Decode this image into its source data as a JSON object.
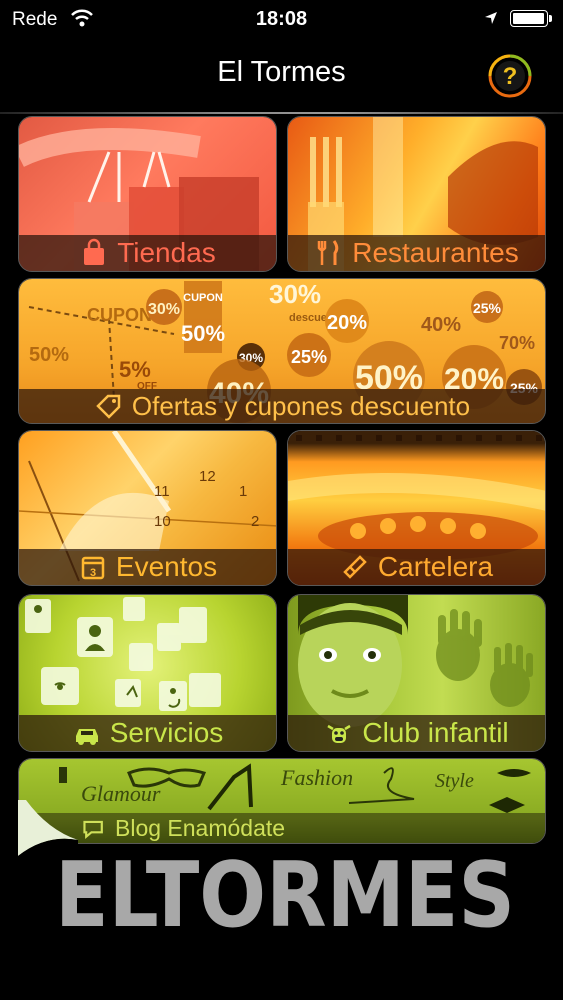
{
  "status_bar": {
    "carrier": "Rede",
    "time": "18:08",
    "battery_level": 1.0
  },
  "navbar": {
    "title": "El Tormes",
    "help_icon": "help-question-icon"
  },
  "tiles": {
    "tiendas": {
      "label": "Tiendas",
      "icon": "shopping-bag-icon"
    },
    "restaurantes": {
      "label": "Restaurantes",
      "icon": "fork-knife-icon"
    },
    "ofertas": {
      "label": "Ofertas y cupones descuento",
      "icon": "tag-icon",
      "art_text": [
        "CUPON",
        "30%",
        "50%",
        "5%",
        "OFF",
        "CUPON",
        "50%",
        "30%",
        "descuento",
        "20%",
        "40%",
        "25%",
        "70%",
        "25%",
        "50%",
        "20%",
        "30%",
        "40%",
        "25%"
      ]
    },
    "eventos": {
      "label": "Eventos",
      "icon": "calendar-icon",
      "art_text": [
        "12",
        "11",
        "10",
        "1",
        "2"
      ]
    },
    "cartelera": {
      "label": "Cartelera",
      "icon": "film-clapper-icon"
    },
    "servicios": {
      "label": "Servicios",
      "icon": "car-icon"
    },
    "club_infantil": {
      "label": "Club infantil",
      "icon": "mascot-cow-icon"
    },
    "blog": {
      "label": "Blog Enamódate",
      "icon": "chat-bubble-icon",
      "art_text": [
        "Glamour",
        "Fashion",
        "Style"
      ]
    }
  },
  "brand_logo": {
    "text": "ELTORMES"
  },
  "colors": {
    "background": "#000000",
    "tiendas": "#ff6a50",
    "restaurantes": "#ff8c3a",
    "ofertas": "#ffc04a",
    "eventos": "#ffb830",
    "cartelera": "#ffaa30",
    "green": "#c9e64a"
  }
}
